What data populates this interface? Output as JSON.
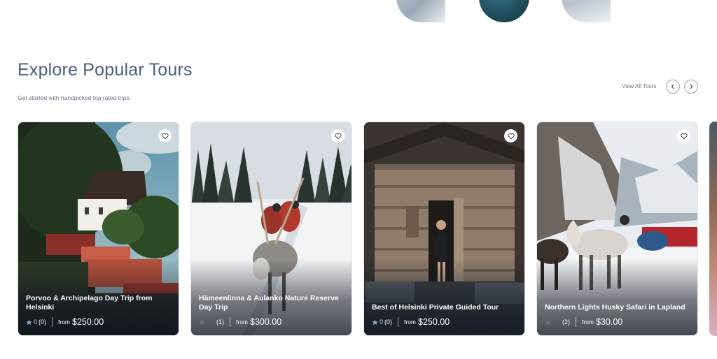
{
  "section": {
    "title": "Explore Popular Tours",
    "subtitle": "Get started with handpicked top rated trips.",
    "view_all_label": "View All Tours"
  },
  "accent_color": "#4a5e7e",
  "icons": {
    "prev": "chevron-left-icon",
    "next": "chevron-right-icon",
    "favorite": "heart-icon",
    "rating": "star-icon"
  },
  "tours": [
    {
      "title": "Porvoo & Archipelago Day Trip from Helsinki",
      "rating": "0",
      "count": "(0)",
      "from_label": "from",
      "price": "$250.00"
    },
    {
      "title": "Hämeenlinna & Aulanko Nature Reserve Day Trip",
      "rating": "",
      "count": "(1)",
      "from_label": "from",
      "price": "$300.00"
    },
    {
      "title": "Best of Helsinki Private Guided Tour",
      "rating": "0",
      "count": "(0)",
      "from_label": "from",
      "price": "$250.00"
    },
    {
      "title": "Northern Lights Husky Safari in Lapland",
      "rating": "",
      "count": "(2)",
      "from_label": "from",
      "price": "$30.00"
    }
  ]
}
